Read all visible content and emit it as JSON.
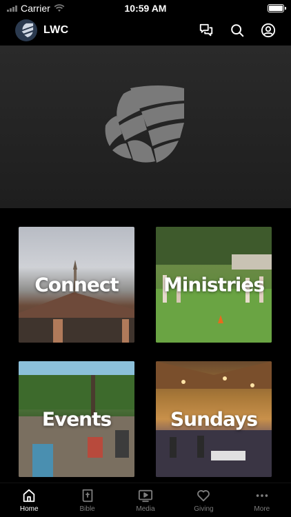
{
  "status": {
    "carrier": "Carrier",
    "time": "10:59 AM"
  },
  "header": {
    "title": "LWC",
    "icons": [
      "chat-icon",
      "search-icon",
      "profile-icon"
    ]
  },
  "tiles": [
    {
      "label": "Connect"
    },
    {
      "label": "Ministries"
    },
    {
      "label": "Events"
    },
    {
      "label": "Sundays"
    }
  ],
  "tabbar": {
    "items": [
      {
        "label": "Home",
        "icon": "home-icon",
        "active": true
      },
      {
        "label": "Bible",
        "icon": "bible-icon",
        "active": false
      },
      {
        "label": "Media",
        "icon": "media-icon",
        "active": false
      },
      {
        "label": "Giving",
        "icon": "heart-icon",
        "active": false
      },
      {
        "label": "More",
        "icon": "more-icon",
        "active": false
      }
    ]
  },
  "colors": {
    "background": "#000000",
    "hero": "#242424",
    "tab_active": "#ffffff",
    "tab_inactive": "#7d7d7d"
  }
}
